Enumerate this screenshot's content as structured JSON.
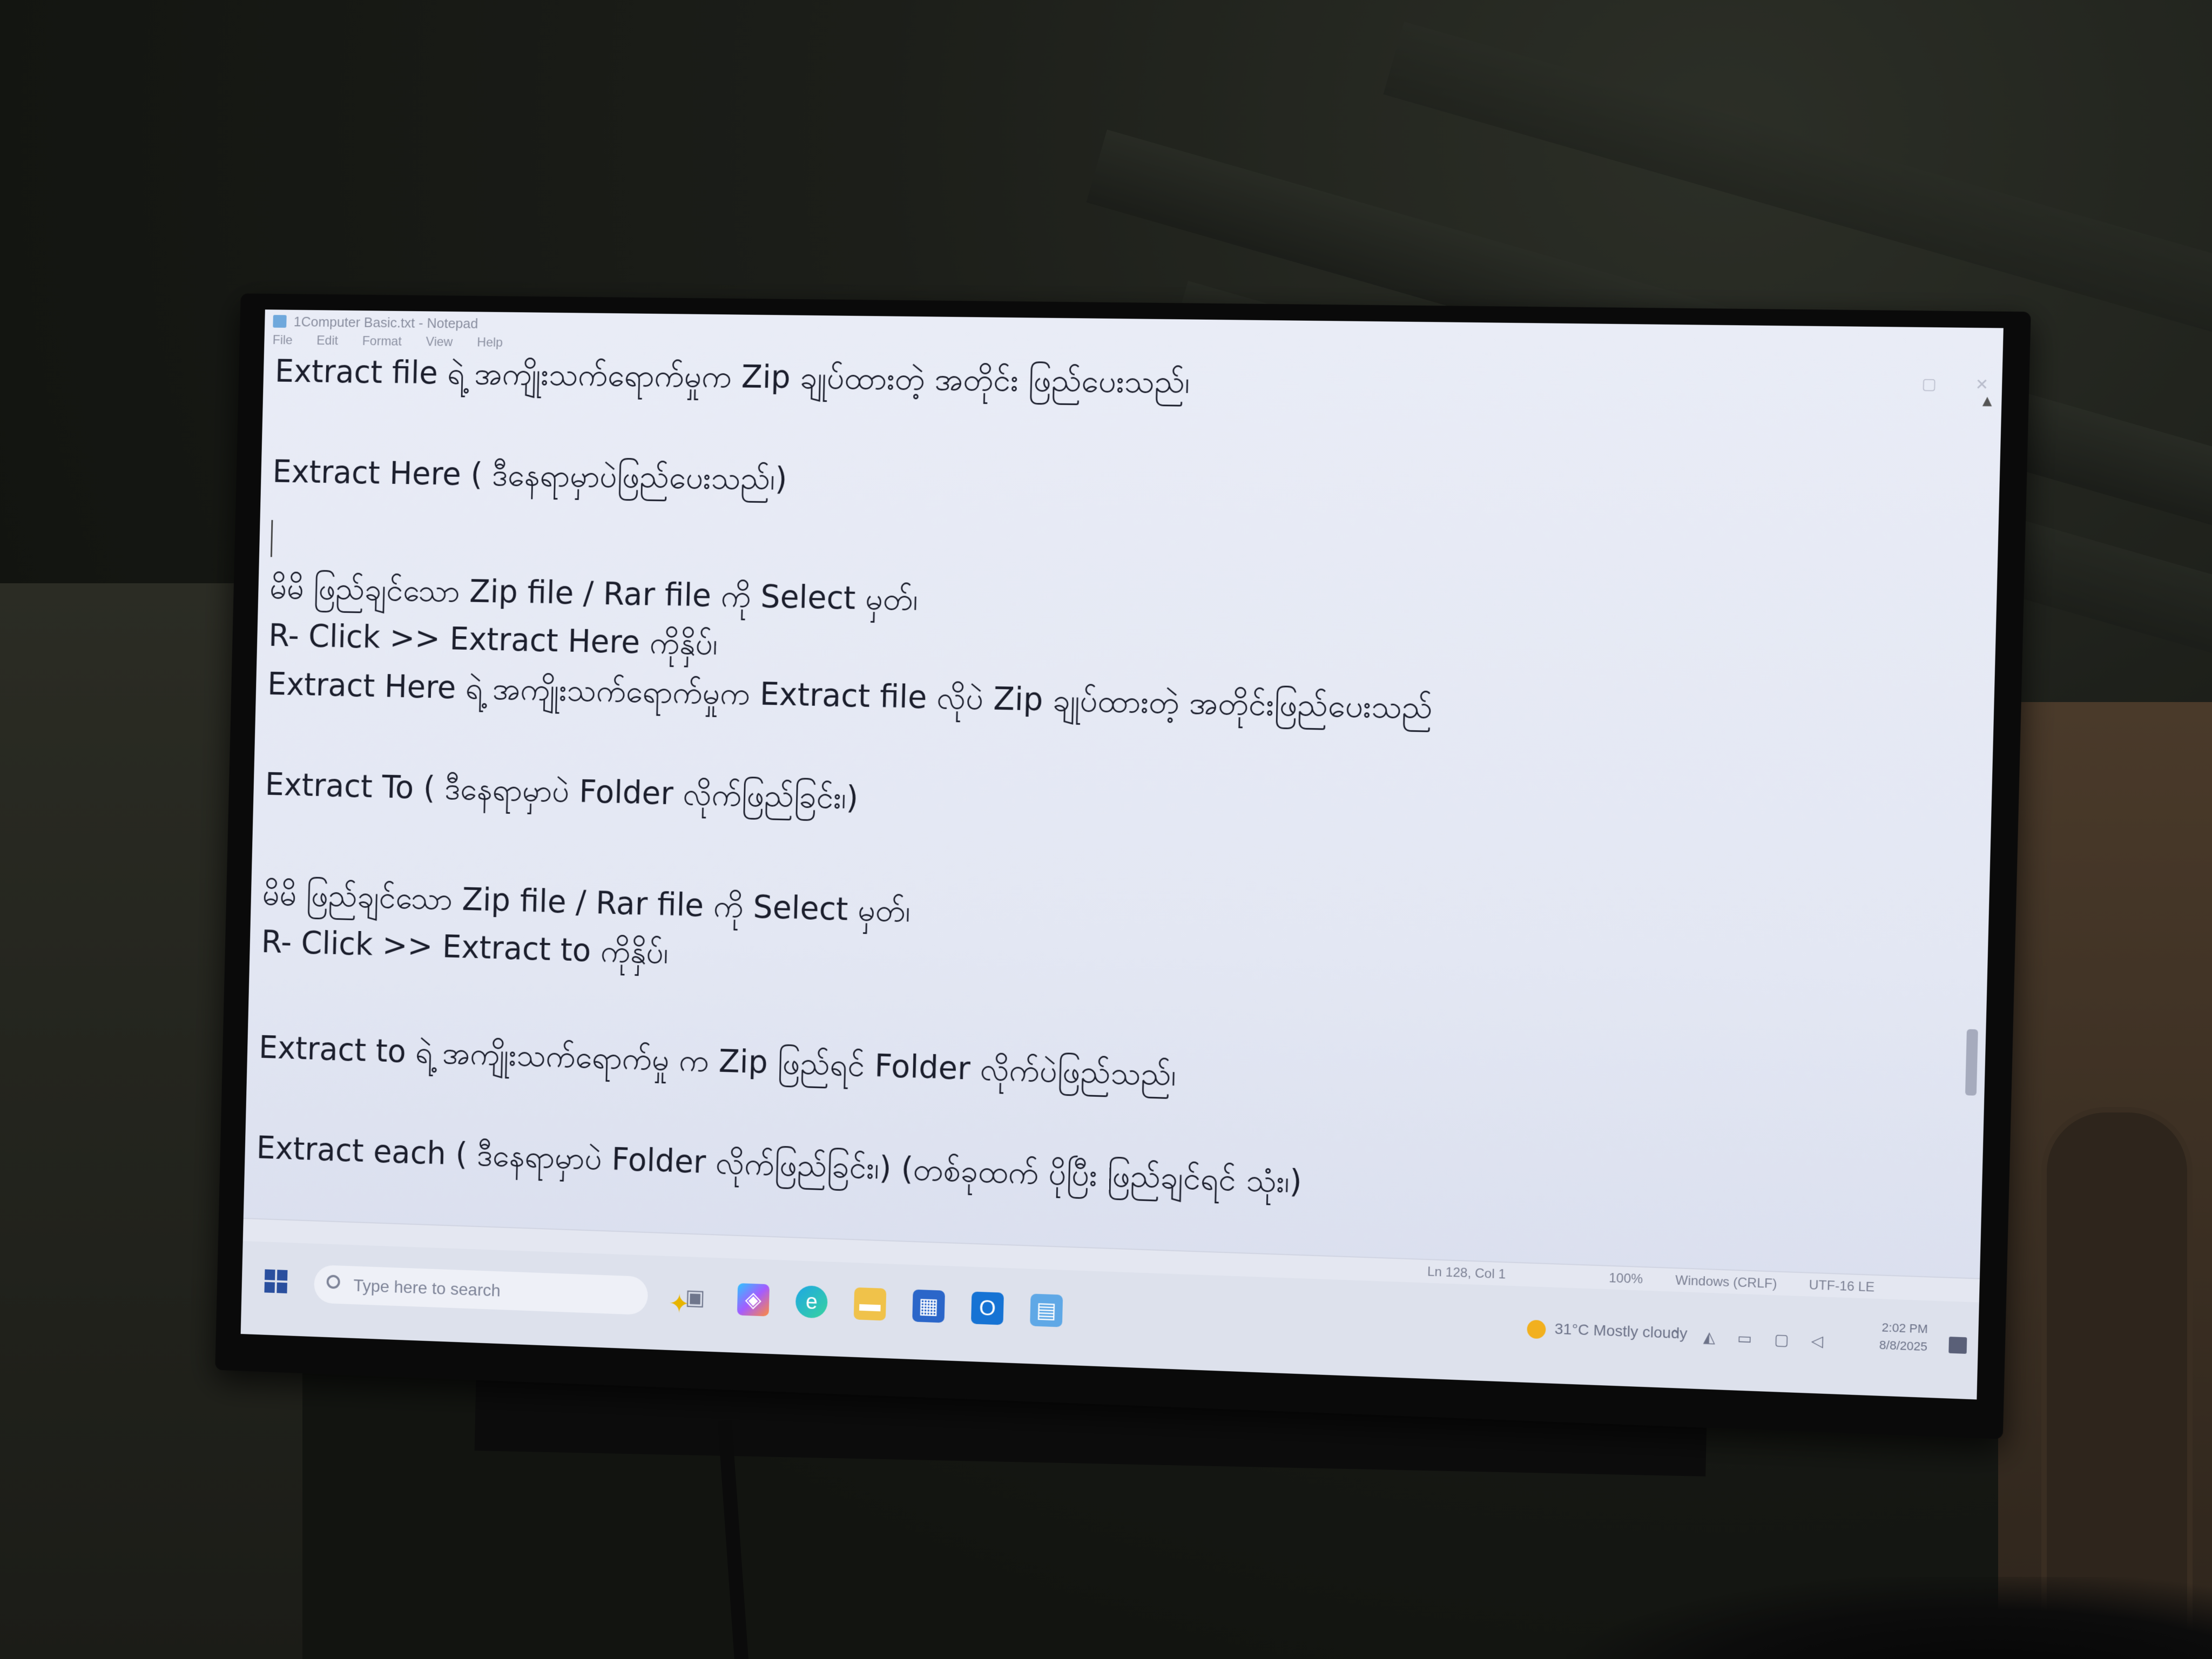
{
  "window": {
    "title": "1Computer Basic.txt - Notepad",
    "menu": [
      "File",
      "Edit",
      "Format",
      "View",
      "Help"
    ]
  },
  "editor": {
    "lines": [
      "Extract file ရဲ့ အကျိုးသက်ရောက်မှုက Zip ချုပ်ထားတဲ့ အတိုင်း ဖြည်ပေးသည်၊",
      "Extract Here ( ဒီနေရာမှာပဲဖြည်ပေးသည်၊)",
      "မိမိ ဖြည်ချင်သော Zip file / Rar file ကို Select မှတ်၊",
      "R- Click >> Extract Here ကိုနှိပ်၊",
      "Extract Here ရဲ့ အကျိုးသက်ရောက်မှုက Extract file လိုပဲ Zip ချုပ်ထားတဲ့ အတိုင်းဖြည်ပေးသည်",
      "Extract To ( ဒီနေရာမှာပဲ Folder လိုက်ဖြည်ခြင်း၊)",
      "မိမိ ဖြည်ချင်သော Zip file / Rar file ကို Select မှတ်၊",
      "R- Click >> Extract to ကိုနှိပ်၊",
      "Extract to ရဲ့ အကျိုးသက်ရောက်မှု က Zip ဖြည်ရင် Folder လိုက်ပဲဖြည်သည်၊",
      "Extract  each ( ဒီနေရာမှာပဲ Folder လိုက်ဖြည်ခြင်း၊) (တစ်ခုထက် ပိုပြီး ဖြည်ချင်ရင် သုံး၊)"
    ]
  },
  "statusbar": {
    "position": "Ln 128, Col 1",
    "zoom": "100%",
    "line_ending": "Windows (CRLF)",
    "encoding": "UTF-16 LE"
  },
  "taskbar": {
    "search_placeholder": "Type here to search",
    "weather": "31°C  Mostly cloudy",
    "time": "2:02 PM",
    "date": "8/8/2025"
  },
  "icons": {
    "start": "windows-start-icon",
    "search": "search-icon",
    "task_view": "task-view-icon",
    "copilot": "copilot-icon",
    "edge": "edge-browser-icon",
    "explorer": "file-explorer-icon",
    "store": "store-icon",
    "outlook": "outlook-icon",
    "notepad": "notepad-icon"
  },
  "colors": {
    "screen_bg": "#e5e8f3",
    "text": "#1b1e2c",
    "taskbar_bg": "#dde1ec"
  }
}
